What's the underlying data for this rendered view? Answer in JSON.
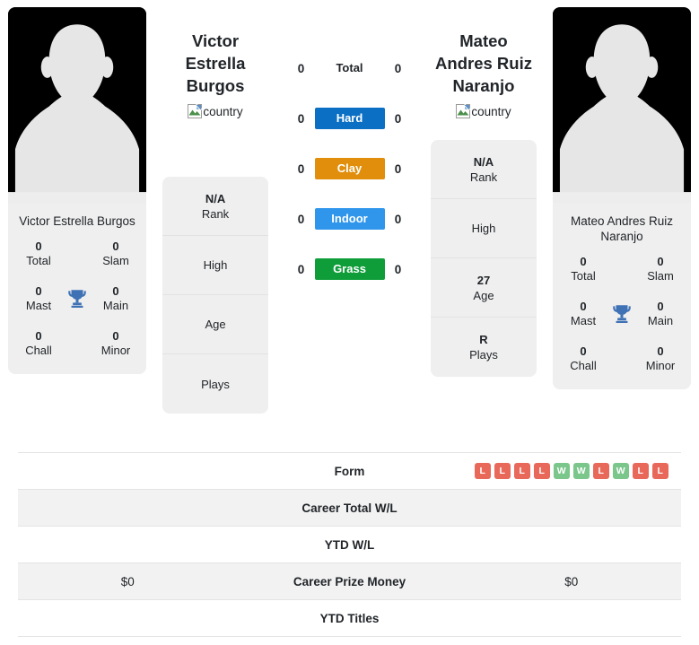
{
  "players": {
    "left": {
      "name": "Victor Estrella Burgos",
      "name_lines": "Victor Estrella Burgos",
      "photo_caption": "Victor Estrella Burgos",
      "flag_alt": "country",
      "titles": {
        "total_value": "0",
        "total_label": "Total",
        "slam_value": "0",
        "slam_label": "Slam",
        "mast_value": "0",
        "mast_label": "Mast",
        "main_value": "0",
        "main_label": "Main",
        "chall_value": "0",
        "chall_label": "Chall",
        "minor_value": "0",
        "minor_label": "Minor"
      },
      "info": {
        "rank_value": "N/A",
        "rank_label": "Rank",
        "high_value": "",
        "high_label": "High",
        "age_value": "",
        "age_label": "Age",
        "plays_value": "",
        "plays_label": "Plays"
      },
      "career_prize_money": "$0",
      "career_total_wl": "",
      "ytd_wl": "",
      "ytd_titles": "",
      "form": []
    },
    "right": {
      "name": "Mateo Andres Ruiz Naranjo",
      "name_lines": "Mateo Andres Ruiz Naranjo",
      "photo_caption": "Mateo Andres Ruiz Naranjo",
      "flag_alt": "country",
      "titles": {
        "total_value": "0",
        "total_label": "Total",
        "slam_value": "0",
        "slam_label": "Slam",
        "mast_value": "0",
        "mast_label": "Mast",
        "main_value": "0",
        "main_label": "Main",
        "chall_value": "0",
        "chall_label": "Chall",
        "minor_value": "0",
        "minor_label": "Minor"
      },
      "info": {
        "rank_value": "N/A",
        "rank_label": "Rank",
        "high_value": "",
        "high_label": "High",
        "age_value": "27",
        "age_label": "Age",
        "plays_value": "R",
        "plays_label": "Plays"
      },
      "career_prize_money": "$0",
      "career_total_wl": "",
      "ytd_wl": "",
      "ytd_titles": "",
      "form": [
        "L",
        "L",
        "L",
        "L",
        "W",
        "W",
        "L",
        "W",
        "L",
        "L"
      ]
    }
  },
  "head_to_head": {
    "rows": [
      {
        "label": "Total",
        "left": "0",
        "right": "0",
        "style": "plain",
        "color": ""
      },
      {
        "label": "Hard",
        "left": "0",
        "right": "0",
        "style": "pill",
        "color": "#0b6fc4"
      },
      {
        "label": "Clay",
        "left": "0",
        "right": "0",
        "style": "pill",
        "color": "#e08e0b"
      },
      {
        "label": "Indoor",
        "left": "0",
        "right": "0",
        "style": "pill",
        "color": "#2f96ec"
      },
      {
        "label": "Grass",
        "left": "0",
        "right": "0",
        "style": "pill",
        "color": "#0f9d3a"
      }
    ]
  },
  "stats_table": {
    "rows": [
      {
        "label": "Form",
        "left": "",
        "right": "",
        "type": "form"
      },
      {
        "label": "Career Total W/L",
        "left": "",
        "right": "",
        "type": "text"
      },
      {
        "label": "YTD W/L",
        "left": "",
        "right": "",
        "type": "text"
      },
      {
        "label": "Career Prize Money",
        "left": "$0",
        "right": "$0",
        "type": "text"
      },
      {
        "label": "YTD Titles",
        "left": "",
        "right": "",
        "type": "text"
      }
    ]
  },
  "colors": {
    "win_badge": "#e8695a",
    "loss_badge": "#e8695a",
    "win": "#7ac68b",
    "loss": "#e8695a",
    "card_bg": "#efefef",
    "row_alt_bg": "#f2f2f2",
    "trophy": "#3f72b5"
  }
}
